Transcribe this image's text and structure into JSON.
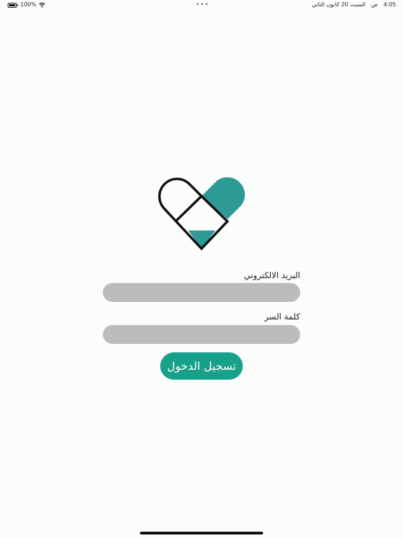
{
  "status_bar": {
    "battery": "100%",
    "time": "4:05",
    "period": "ص",
    "date": "السبت 20 كانون الثاني",
    "dots": "•••"
  },
  "icons": {
    "battery": "battery-icon",
    "wifi": "wifi-icon",
    "logo": "heart-pill-logo"
  },
  "colors": {
    "accent": "#17a08a",
    "logo_teal": "#2e9a96",
    "input_background": "#bbbdbd"
  },
  "login": {
    "email_label": "البريد الالكتروني",
    "email_value": "",
    "password_label": "كلمة السر",
    "password_value": "",
    "submit_label": "تسجيل الدخول"
  }
}
